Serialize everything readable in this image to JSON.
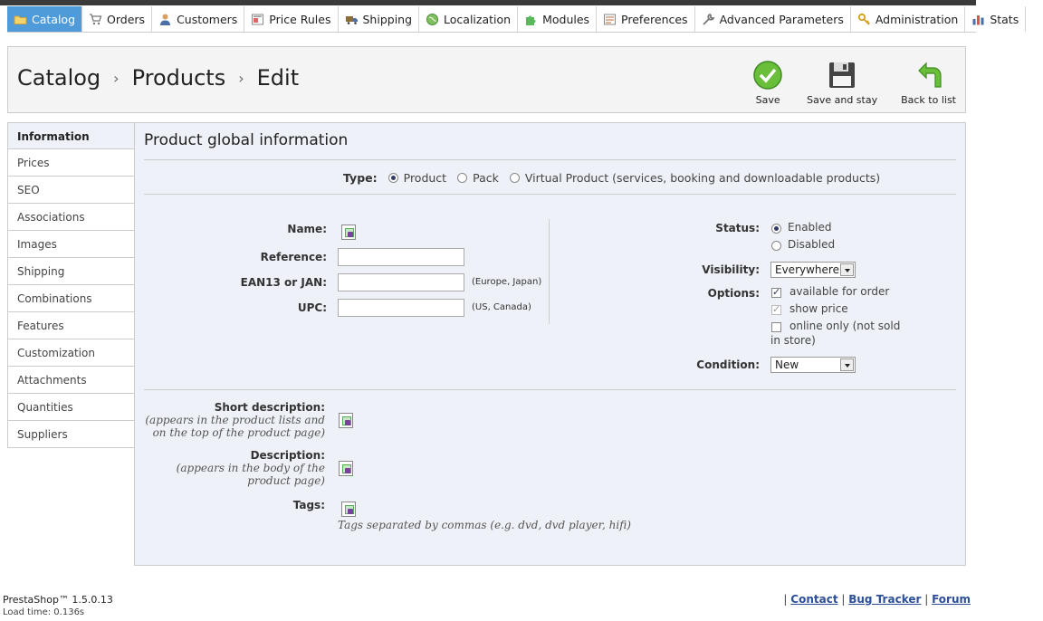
{
  "nav": {
    "tabs": [
      {
        "label": "Catalog",
        "icon": "folder-icon",
        "active": true
      },
      {
        "label": "Orders",
        "icon": "cart-icon",
        "active": false
      },
      {
        "label": "Customers",
        "icon": "user-icon",
        "active": false
      },
      {
        "label": "Price Rules",
        "icon": "price-tag-icon",
        "active": false
      },
      {
        "label": "Shipping",
        "icon": "truck-icon",
        "active": false
      },
      {
        "label": "Localization",
        "icon": "globe-icon",
        "active": false
      },
      {
        "label": "Modules",
        "icon": "puzzle-icon",
        "active": false
      },
      {
        "label": "Preferences",
        "icon": "preferences-icon",
        "active": false
      },
      {
        "label": "Advanced Parameters",
        "icon": "wrench-icon",
        "active": false
      },
      {
        "label": "Administration",
        "icon": "key-icon",
        "active": false
      },
      {
        "label": "Stats",
        "icon": "bar-chart-icon",
        "active": false
      }
    ]
  },
  "header": {
    "breadcrumb": [
      "Catalog",
      "Products",
      "Edit"
    ],
    "toolbar": {
      "save": "Save",
      "save_and_stay": "Save and stay",
      "back_to_list": "Back to list"
    }
  },
  "sidebar": {
    "items": [
      "Information",
      "Prices",
      "SEO",
      "Associations",
      "Images",
      "Shipping",
      "Combinations",
      "Features",
      "Customization",
      "Attachments",
      "Quantities",
      "Suppliers"
    ],
    "active": "Information"
  },
  "form": {
    "title": "Product global information",
    "type": {
      "label": "Type:",
      "options": [
        "Product",
        "Pack",
        "Virtual Product (services, booking and downloadable products)"
      ],
      "selected": "Product"
    },
    "name_label": "Name:",
    "reference_label": "Reference:",
    "reference_value": "",
    "ean_label": "EAN13 or JAN:",
    "ean_value": "",
    "ean_hint": "(Europe, Japan)",
    "upc_label": "UPC:",
    "upc_value": "",
    "upc_hint": "(US, Canada)",
    "status": {
      "label": "Status:",
      "options": [
        "Enabled",
        "Disabled"
      ],
      "selected": "Enabled"
    },
    "visibility": {
      "label": "Visibility:",
      "value": "Everywhere"
    },
    "options": {
      "label": "Options:",
      "available_for_order": "available for order",
      "show_price": "show price",
      "online_only_1": "online only (not sold",
      "online_only_2": "in store)"
    },
    "condition": {
      "label": "Condition:",
      "value": "New"
    },
    "short_description": {
      "label": "Short description:",
      "hint": "(appears in the product lists and on the top of the product page)"
    },
    "description": {
      "label": "Description:",
      "hint": "(appears in the body of the product page)"
    },
    "tags": {
      "label": "Tags:",
      "hint": "Tags separated by commas (e.g. dvd, dvd player, hifi)"
    }
  },
  "footer": {
    "version": "PrestaShop™ 1.5.0.13",
    "load_time": "Load time: 0.136s",
    "links": [
      "Contact",
      "Bug Tracker",
      "Forum"
    ]
  }
}
